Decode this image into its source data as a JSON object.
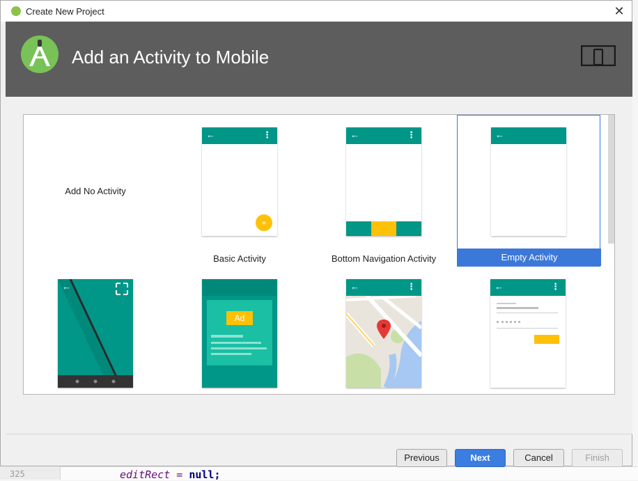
{
  "window": {
    "title": "Create New Project",
    "close_glyph": "✕"
  },
  "header": {
    "title": "Add an Activity to Mobile",
    "logo_icon": "android-studio-icon",
    "device_icon": "phone-tablet-icon"
  },
  "activities": [
    {
      "label": "Add No Activity",
      "selected": false
    },
    {
      "label": "Basic Activity",
      "selected": false
    },
    {
      "label": "Bottom Navigation Activity",
      "selected": false
    },
    {
      "label": "Empty Activity",
      "selected": true
    },
    {
      "label": "",
      "selected": false
    },
    {
      "label": "",
      "selected": false
    },
    {
      "label": "",
      "selected": false
    },
    {
      "label": "",
      "selected": false
    }
  ],
  "preview": {
    "back_glyph": "←",
    "menu_glyph": "⋮",
    "fab_glyph": "+",
    "ad_text": "Ad"
  },
  "buttons": {
    "previous": "Previous",
    "next": "Next",
    "cancel": "Cancel",
    "finish": "Finish"
  },
  "background": {
    "line_number": "325",
    "code_var": "editRect",
    "code_op": "=",
    "code_kw": "null;"
  },
  "colors": {
    "accent": "#3b78d9",
    "header_bg": "#5d5d5d",
    "teal": "#009688",
    "amber": "#ffc107"
  }
}
